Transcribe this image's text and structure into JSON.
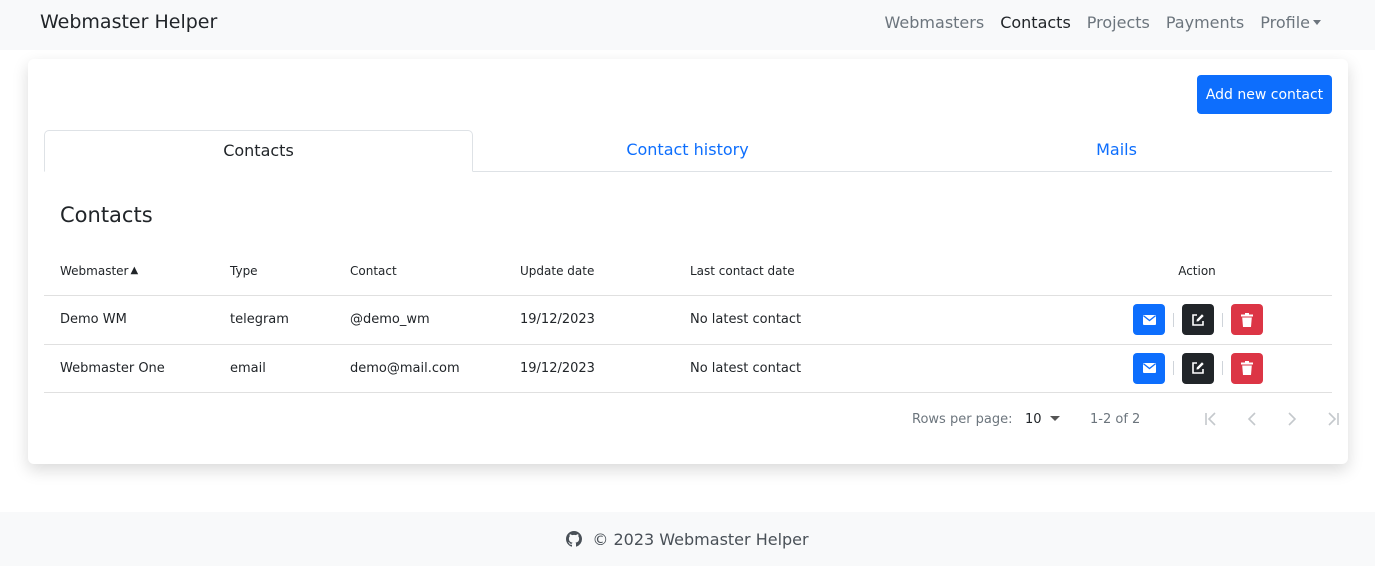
{
  "navbar": {
    "brand": "Webmaster Helper",
    "links": [
      {
        "label": "Webmasters",
        "active": false
      },
      {
        "label": "Contacts",
        "active": true
      },
      {
        "label": "Projects",
        "active": false
      },
      {
        "label": "Payments",
        "active": false
      },
      {
        "label": "Profile",
        "active": false,
        "dropdown": true
      }
    ]
  },
  "page": {
    "add_button": "Add new contact",
    "tabs": [
      {
        "label": "Contacts",
        "active": true
      },
      {
        "label": "Contact history",
        "active": false
      },
      {
        "label": "Mails",
        "active": false
      }
    ],
    "section_title": "Contacts"
  },
  "table": {
    "sort_indicator": "▲",
    "columns": [
      "Webmaster",
      "Type",
      "Contact",
      "Update date",
      "Last contact date",
      "Action"
    ],
    "rows": [
      {
        "webmaster": "Demo WM",
        "type": "telegram",
        "contact": "@demo_wm",
        "update_date": "19/12/2023",
        "last_contact": "No latest contact"
      },
      {
        "webmaster": "Webmaster One",
        "type": "email",
        "contact": "demo@mail.com",
        "update_date": "19/12/2023",
        "last_contact": "No latest contact"
      }
    ],
    "action_icons": [
      "envelope-icon",
      "edit-icon",
      "trash-icon"
    ]
  },
  "pagination": {
    "rows_per_page_label": "Rows per page:",
    "rows_per_page_value": "10",
    "range": "1-2 of 2"
  },
  "footer": {
    "text": "© 2023 Webmaster Helper",
    "icon": "github-icon"
  },
  "colors": {
    "primary": "#0d6efd",
    "dark": "#212529",
    "danger": "#dc3545",
    "navbar_bg": "#f8f9fa"
  }
}
